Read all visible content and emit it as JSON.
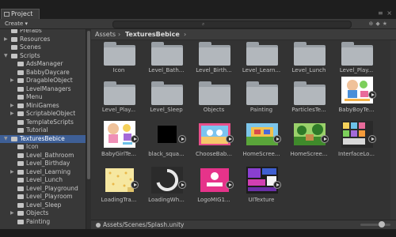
{
  "window": {
    "tab_label": "Project",
    "controls": "≡ ×"
  },
  "toolbar": {
    "create_label": "Create ▾"
  },
  "sidebar": {
    "items": [
      {
        "label": "Prefabs",
        "depth": 1,
        "arrow": false,
        "selected": false
      },
      {
        "label": "Resources",
        "depth": 1,
        "arrow": true,
        "selected": false
      },
      {
        "label": "Scenes",
        "depth": 1,
        "arrow": false,
        "selected": false
      },
      {
        "label": "Scripts",
        "depth": 1,
        "arrow": "open",
        "selected": false
      },
      {
        "label": "AdsManager",
        "depth": 2,
        "arrow": false,
        "selected": false
      },
      {
        "label": "BabbyDaycare",
        "depth": 2,
        "arrow": false,
        "selected": false
      },
      {
        "label": "DragableObject",
        "depth": 2,
        "arrow": true,
        "selected": false
      },
      {
        "label": "LevelManagers",
        "depth": 2,
        "arrow": false,
        "selected": false
      },
      {
        "label": "Menu",
        "depth": 2,
        "arrow": false,
        "selected": false
      },
      {
        "label": "MiniGames",
        "depth": 2,
        "arrow": true,
        "selected": false
      },
      {
        "label": "ScriptableObject",
        "depth": 2,
        "arrow": true,
        "selected": false
      },
      {
        "label": "TemplateScripts",
        "depth": 2,
        "arrow": false,
        "selected": false
      },
      {
        "label": "Tutorial",
        "depth": 2,
        "arrow": false,
        "selected": false
      },
      {
        "label": "TexturesBebice",
        "depth": 1,
        "arrow": "open",
        "selected": true
      },
      {
        "label": "Icon",
        "depth": 2,
        "arrow": false,
        "selected": false
      },
      {
        "label": "Level_Bathroom",
        "depth": 2,
        "arrow": false,
        "selected": false
      },
      {
        "label": "Level_Birthday",
        "depth": 2,
        "arrow": false,
        "selected": false
      },
      {
        "label": "Level_Learning",
        "depth": 2,
        "arrow": true,
        "selected": false
      },
      {
        "label": "Level_Lunch",
        "depth": 2,
        "arrow": false,
        "selected": false
      },
      {
        "label": "Level_Playground",
        "depth": 2,
        "arrow": false,
        "selected": false
      },
      {
        "label": "Level_Playroom",
        "depth": 2,
        "arrow": false,
        "selected": false
      },
      {
        "label": "Level_Sleep",
        "depth": 2,
        "arrow": false,
        "selected": false
      },
      {
        "label": "Objects",
        "depth": 2,
        "arrow": true,
        "selected": false
      },
      {
        "label": "Painting",
        "depth": 2,
        "arrow": false,
        "selected": false
      }
    ]
  },
  "breadcrumb": {
    "root": "Assets",
    "separator": "›",
    "current": "TexturesBebice",
    "trailing": "›"
  },
  "assets": [
    {
      "label": "Icon",
      "kind": "folder"
    },
    {
      "label": "Level_Bath...",
      "kind": "folder"
    },
    {
      "label": "Level_Birth...",
      "kind": "folder"
    },
    {
      "label": "Level_Learn...",
      "kind": "folder"
    },
    {
      "label": "Level_Lunch",
      "kind": "folder"
    },
    {
      "label": "Level_Play...",
      "kind": "folder"
    },
    {
      "label": "Level_Play...",
      "kind": "folder"
    },
    {
      "label": "Level_Sleep",
      "kind": "folder"
    },
    {
      "label": "Objects",
      "kind": "folder"
    },
    {
      "label": "Painting",
      "kind": "folder"
    },
    {
      "label": "ParticlesTe...",
      "kind": "folder"
    },
    {
      "label": "BabyBoyTe...",
      "kind": "texture",
      "thumb": "boy"
    },
    {
      "label": "BabyGirlTe...",
      "kind": "texture",
      "thumb": "girl"
    },
    {
      "label": "black_squa...",
      "kind": "texture",
      "thumb": "black"
    },
    {
      "label": "ChooseBab...",
      "kind": "texture",
      "thumb": "choose"
    },
    {
      "label": "HomeScree...",
      "kind": "texture",
      "thumb": "home1"
    },
    {
      "label": "HomeScree...",
      "kind": "texture",
      "thumb": "home2"
    },
    {
      "label": "InterfaceLo...",
      "kind": "texture",
      "thumb": "iface"
    },
    {
      "label": "LoadingTra...",
      "kind": "texture",
      "thumb": "loadtra"
    },
    {
      "label": "LoadingWh...",
      "kind": "texture",
      "thumb": "loadwh"
    },
    {
      "label": "LogoMIG1...",
      "kind": "texture",
      "thumb": "logo"
    },
    {
      "label": "UITexture",
      "kind": "texture",
      "thumb": "ui"
    }
  ],
  "status": {
    "path": "Assets/Scenes/Splash.unity"
  },
  "colors": {
    "selection": "#3e5f96",
    "panel": "#383838",
    "grid_bg": "#333333"
  }
}
